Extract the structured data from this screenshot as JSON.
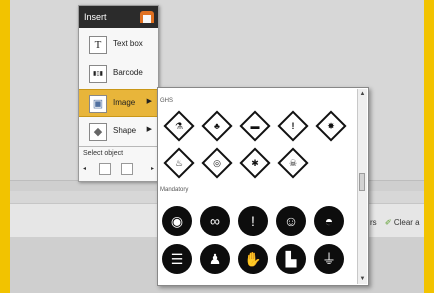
{
  "menu": {
    "title": "Insert",
    "items": [
      {
        "label": "Text box",
        "icon": "text-box-icon",
        "glyph": "T"
      },
      {
        "label": "Barcode",
        "icon": "barcode-icon",
        "glyph": "▮▯▮"
      },
      {
        "label": "Image",
        "icon": "image-icon",
        "glyph": "▣"
      },
      {
        "label": "Shape",
        "icon": "shape-icon",
        "glyph": "◆"
      }
    ],
    "select_object": "Select object",
    "select_left": "◂",
    "select_right": "▸"
  },
  "gallery": {
    "section_ghs": "GHS",
    "section_mandatory": "Mandatory",
    "ghs_symbols": [
      "corrosion",
      "environment",
      "gas-cylinder",
      "exclamation",
      "explosive",
      "flame",
      "oxidizer",
      "health-hazard",
      "toxic"
    ],
    "mandatory_symbols": [
      "ear-protection",
      "eye-protection",
      "general-mandatory",
      "face-shield",
      "head-protection",
      "read-manual",
      "protective-clothing",
      "hand-protection",
      "foot-protection",
      "earth"
    ]
  },
  "toolbar": {
    "clear_label": "Clear a",
    "partial_text": "rs"
  },
  "colors": {
    "accent": "#e8b53a",
    "frame": "#f2c300",
    "header": "#2b2b2b"
  }
}
